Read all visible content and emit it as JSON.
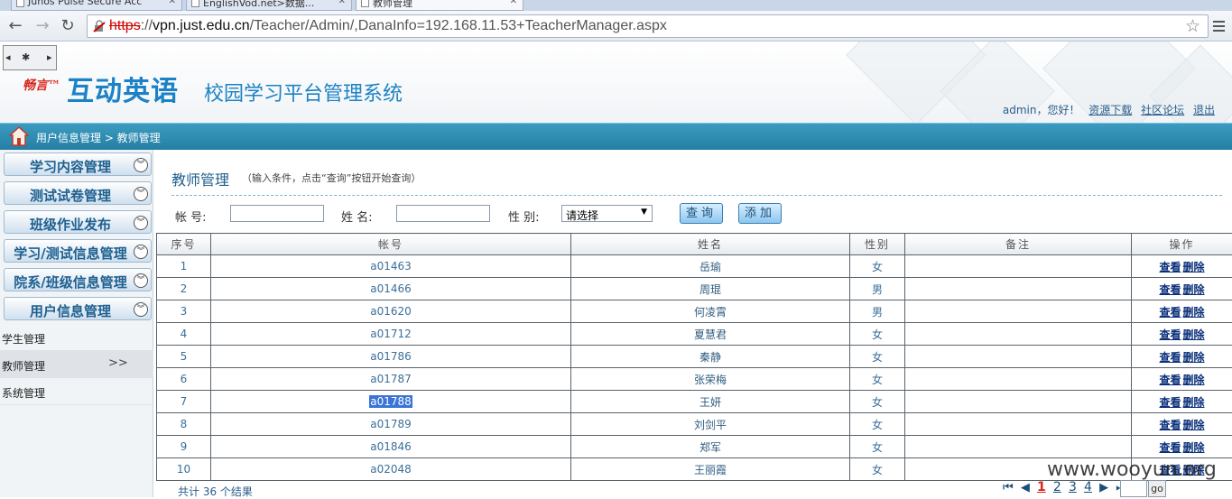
{
  "browser": {
    "tabs": [
      {
        "label": "Junos Pulse Secure Acc"
      },
      {
        "label": "EnglishVod.net>数据..."
      },
      {
        "label": "教师管理"
      }
    ],
    "url_scheme": "https",
    "url_host": "vpn.just.edu.cn",
    "url_path": "/Teacher/Admin/,DanaInfo=192.168.11.53+TeacherManager.aspx"
  },
  "header": {
    "brand_small": "畅言™",
    "brand_big": "互动英语",
    "brand_sub": "校园学习平台管理系统",
    "greeting": "admin，您好！",
    "links": [
      "资源下载",
      "社区论坛",
      "退出"
    ]
  },
  "breadcrumb": "用户信息管理 > 教师管理",
  "sidebar": {
    "groups": [
      {
        "label": "学习内容管理"
      },
      {
        "label": "测试试卷管理"
      },
      {
        "label": "班级作业发布"
      },
      {
        "label": "学习/测试信息管理"
      },
      {
        "label": "院系/班级信息管理"
      },
      {
        "label": "用户信息管理"
      }
    ],
    "items": [
      {
        "label": "学生管理"
      },
      {
        "label": "教师管理",
        "arrow": ">>"
      },
      {
        "label": "系统管理"
      }
    ]
  },
  "main": {
    "title": "教师管理",
    "hint": "（输入条件，点击“查询”按钮开始查询）",
    "filters": {
      "account_label": "帐 号:",
      "name_label": "姓 名:",
      "gender_label": "性 别:",
      "gender_value": "请选择",
      "query_button": "查询",
      "add_button": "添加"
    },
    "table": {
      "columns": [
        "序号",
        "帐号",
        "姓名",
        "性别",
        "备注",
        "操作"
      ],
      "rows": [
        {
          "no": "1",
          "account": "a01463",
          "name": "岳瑜",
          "gender": "女",
          "note": ""
        },
        {
          "no": "2",
          "account": "a01466",
          "name": "周琨",
          "gender": "男",
          "note": ""
        },
        {
          "no": "3",
          "account": "a01620",
          "name": "何凌霄",
          "gender": "男",
          "note": ""
        },
        {
          "no": "4",
          "account": "a01712",
          "name": "夏慧君",
          "gender": "女",
          "note": ""
        },
        {
          "no": "5",
          "account": "a01786",
          "name": "秦静",
          "gender": "女",
          "note": ""
        },
        {
          "no": "6",
          "account": "a01787",
          "name": "张荣梅",
          "gender": "女",
          "note": ""
        },
        {
          "no": "7",
          "account": "a01788",
          "name": "王妍",
          "gender": "女",
          "note": ""
        },
        {
          "no": "8",
          "account": "a01789",
          "name": "刘剑平",
          "gender": "女",
          "note": ""
        },
        {
          "no": "9",
          "account": "a01846",
          "name": "郑军",
          "gender": "女",
          "note": ""
        },
        {
          "no": "10",
          "account": "a02048",
          "name": "王丽霞",
          "gender": "女",
          "note": ""
        }
      ],
      "ops": [
        "查看",
        "删除"
      ]
    },
    "total": "共计 36 个结果",
    "pager": {
      "first": "⏮",
      "prev": "◀",
      "pages": [
        "1",
        "2",
        "3",
        "4"
      ],
      "current": "1",
      "next": "▶",
      "last": "⏭",
      "go": "go"
    }
  },
  "watermark": "www.wooyun.org"
}
